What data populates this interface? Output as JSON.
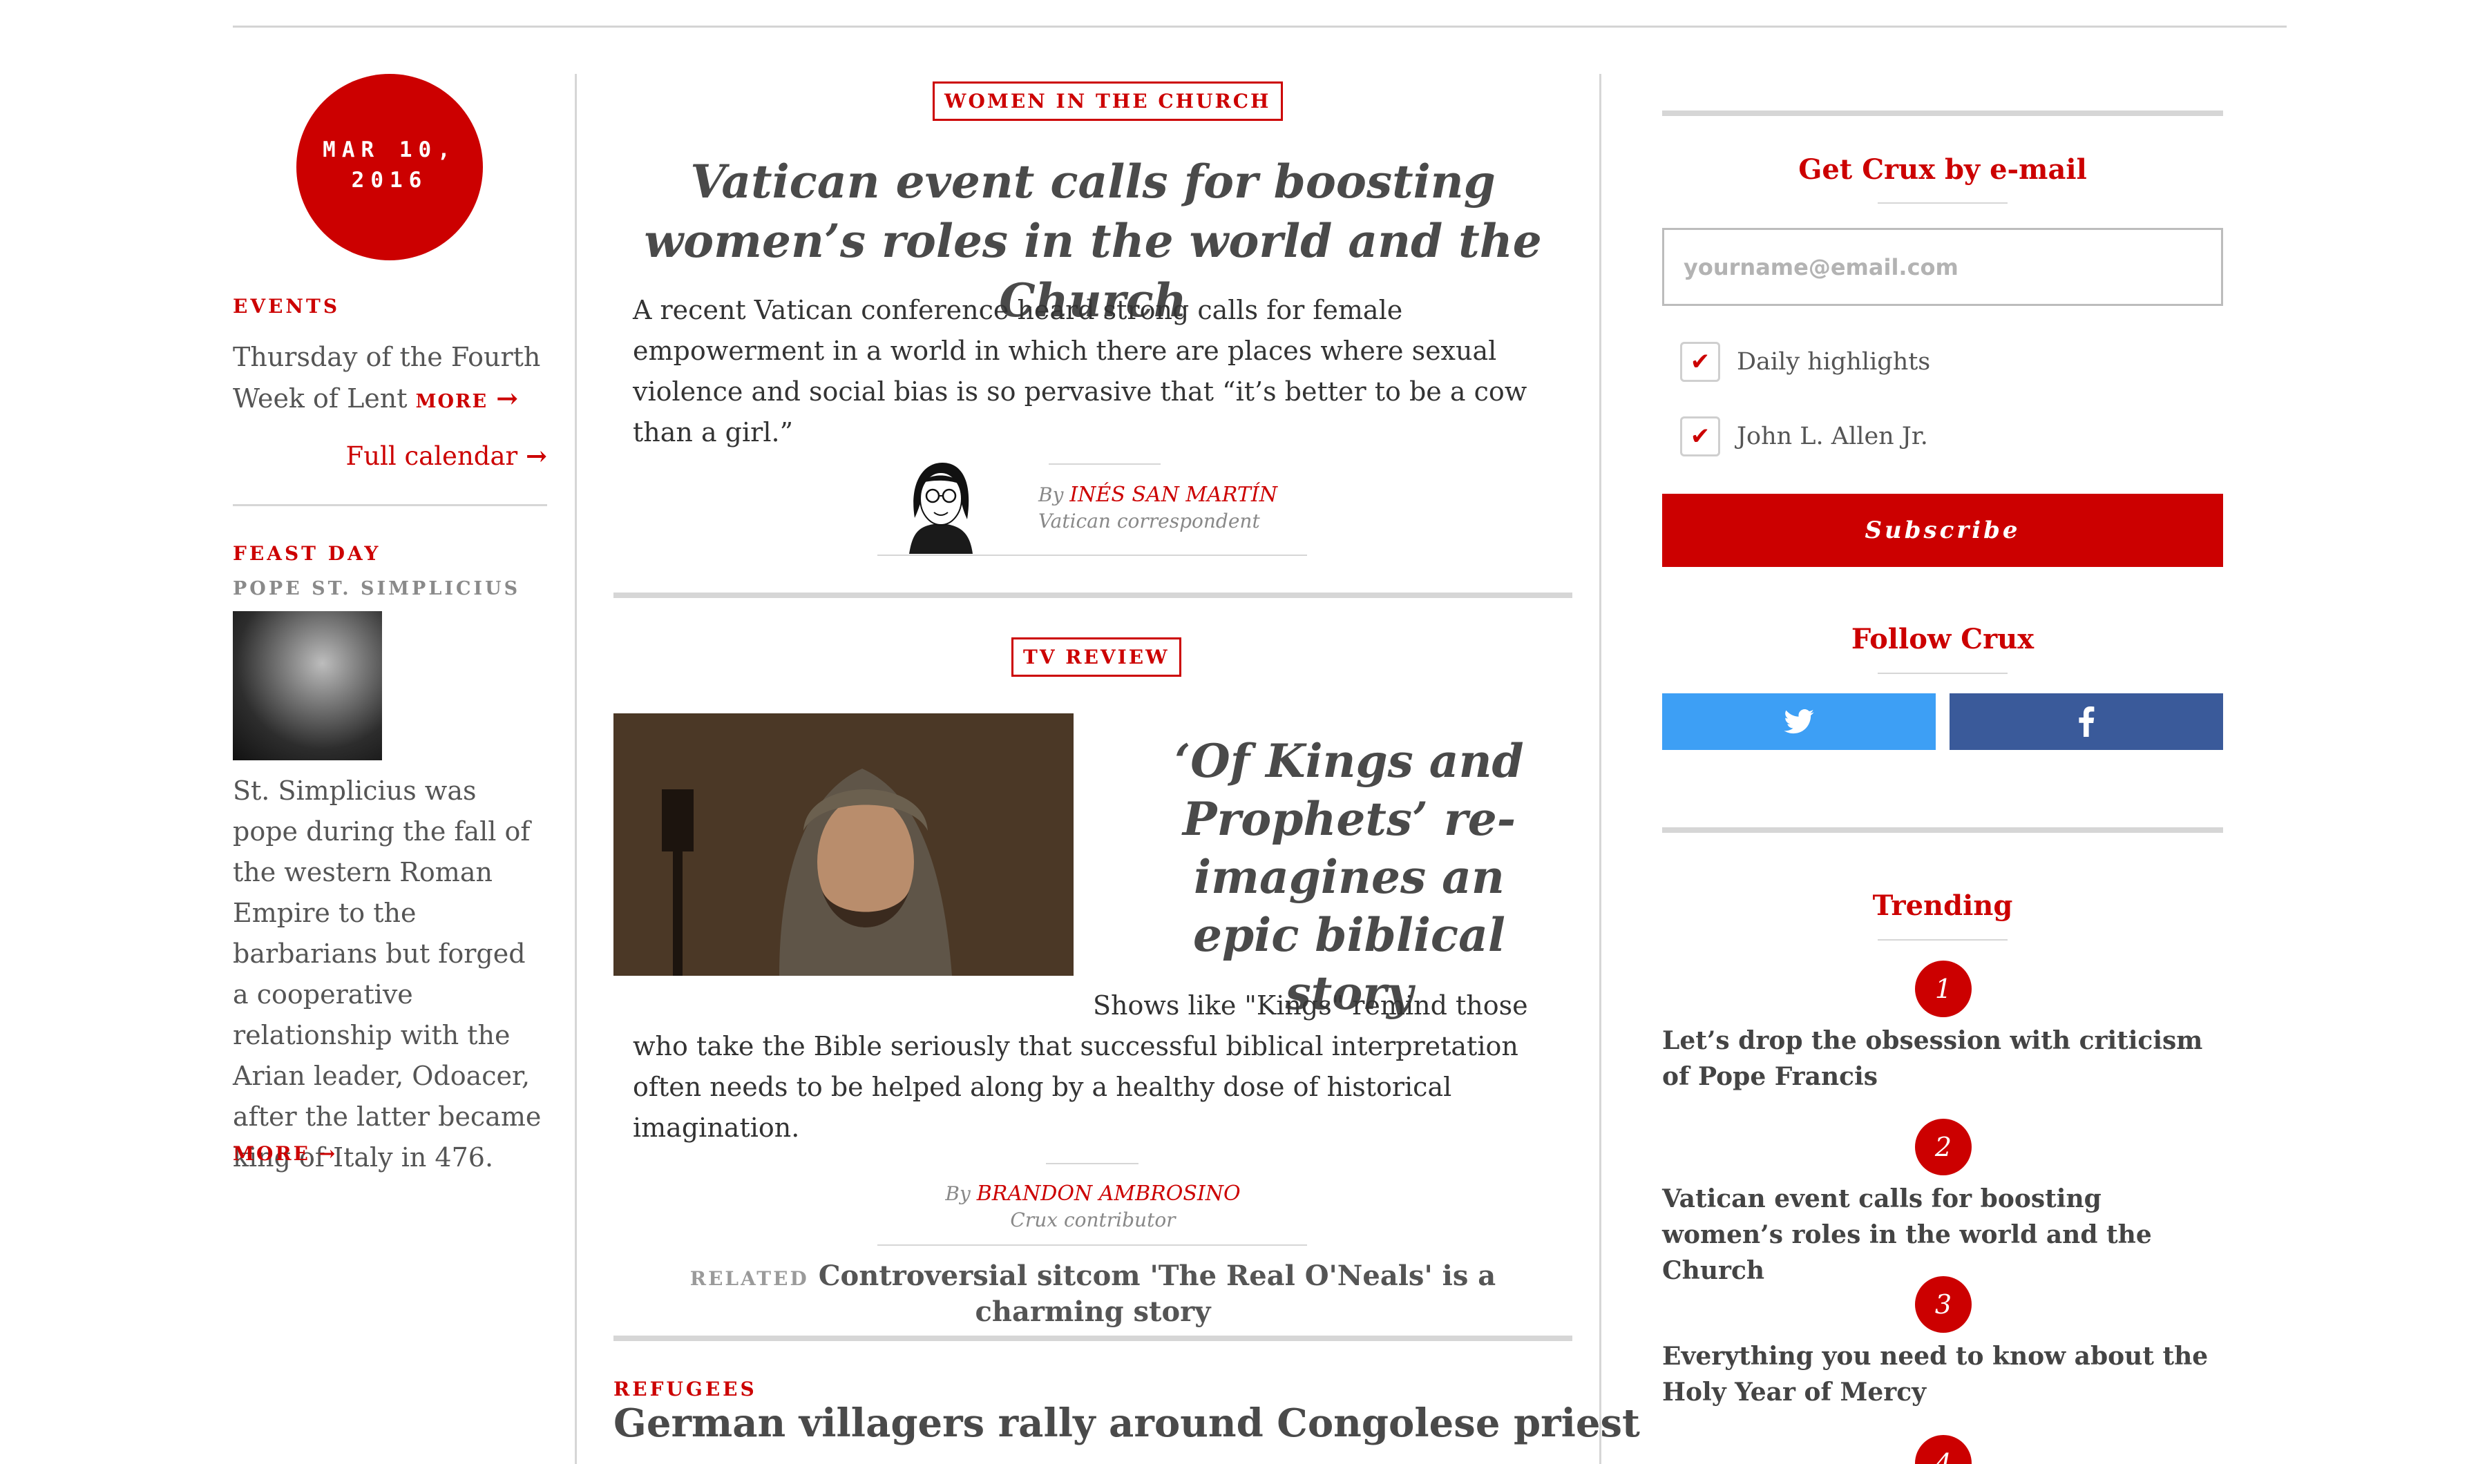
{
  "left": {
    "date": "MAR 10, 2016",
    "events_kicker": "EVENTS",
    "events_text": "Thursday of the Fourth Week of Lent",
    "events_more": "MORE",
    "full_calendar": "Full calendar",
    "feast_kicker": "FEAST DAY",
    "feast_saint": "POPE ST. SIMPLICIUS",
    "feast_text": "St. Simplicius was pope during the fall of the western Roman Empire to the barbarians but forged a cooperative relationship with the Arian leader, Odoacer, after the latter became king of Italy in 476.",
    "feast_more": "MORE"
  },
  "main": {
    "story1": {
      "tag": "WOMEN IN THE CHURCH",
      "headline": "Vatican event calls for boosting women’s roles in the world and the Church",
      "dek": "A recent Vatican conference heard strong calls for female empowerment in a world in which there are places where sexual violence and social bias is so pervasive that “it’s better to be a cow than a girl.”",
      "by": "By",
      "author": "INÉS SAN MARTÍN",
      "role": "Vatican correspondent"
    },
    "story2": {
      "tag": "TV REVIEW",
      "headline": "‘Of Kings and Prophets’ re-imagines an epic biblical story",
      "dek": "Shows like \"Kings\" remind those who take the Bible seriously that successful biblical interpretation often needs to be helped along by a healthy dose of historical imagination.",
      "by": "By",
      "author": "BRANDON AMBROSINO",
      "role": "Crux contributor",
      "related_label": "RELATED",
      "related_title": "Controversial sitcom 'The Real O'Neals' is a charming story"
    },
    "story3": {
      "kicker": "REFUGEES",
      "headline": "German villagers rally around Congolese priest"
    }
  },
  "sidebar": {
    "email_title": "Get Crux by e-mail",
    "email_placeholder": "yourname@email.com",
    "options": [
      "Daily highlights",
      "John L. Allen Jr."
    ],
    "subscribe": "Subscribe",
    "follow_title": "Follow Crux",
    "trending_title": "Trending",
    "trending": [
      {
        "num": "1",
        "title": "Let’s drop the obsession with criticism of Pope Francis"
      },
      {
        "num": "2",
        "title": "Vatican event calls for boosting women’s roles in the world and the Church"
      },
      {
        "num": "3",
        "title": "Everything you need to know about the Holy Year of Mercy"
      },
      {
        "num": "4",
        "title": ""
      }
    ]
  },
  "colors": {
    "accent": "#cc0000",
    "twitter": "#3d9ff5",
    "facebook": "#3a5a9a",
    "rule": "#d6d6d6"
  },
  "icons": {
    "twitter": "twitter-icon",
    "facebook": "facebook-icon",
    "arrow": "arrow-right-icon",
    "check": "check-icon"
  }
}
